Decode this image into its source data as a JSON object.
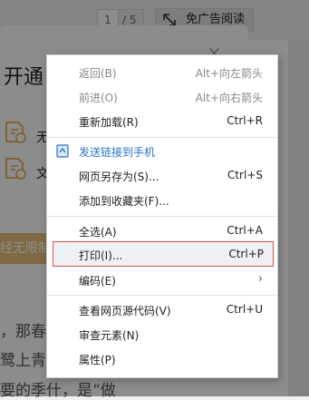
{
  "toolbar": {
    "page_current": "1",
    "page_total": "/ 5",
    "adfree_label": "免广告阅读"
  },
  "popup": {
    "title": "开通",
    "feature_1": "无",
    "feature_2": "文",
    "cta_label": "经无限制",
    "close_glyph": "×"
  },
  "document": {
    "line_1": "",
    "line_2": "，那春",
    "line_3": "鹭上青",
    "line_4": "要的季什，是“做"
  },
  "context_menu": {
    "back": {
      "label": "返回(B)",
      "shortcut": "Alt+向左箭头"
    },
    "forward": {
      "label": "前进(O)",
      "shortcut": "Alt+向右箭头"
    },
    "reload": {
      "label": "重新加载(R)",
      "shortcut": "Ctrl+R"
    },
    "send_to_phone": {
      "label": "发送链接到手机"
    },
    "save_as": {
      "label": "网页另存为(S)...",
      "shortcut": "Ctrl+S"
    },
    "add_favorite": {
      "label": "添加到收藏夹(F)..."
    },
    "select_all": {
      "label": "全选(A)",
      "shortcut": "Ctrl+A"
    },
    "print": {
      "label": "打印(I)...",
      "shortcut": "Ctrl+P"
    },
    "encoding": {
      "label": "编码(E)"
    },
    "view_source": {
      "label": "查看网页源代码(V)",
      "shortcut": "Ctrl+U"
    },
    "inspect": {
      "label": "审查元素(N)"
    },
    "properties": {
      "label": "属性(P)"
    }
  },
  "colors": {
    "highlight_border": "#d9534f",
    "link_blue": "#2a73c9",
    "cta_gold": "#e7c078"
  }
}
